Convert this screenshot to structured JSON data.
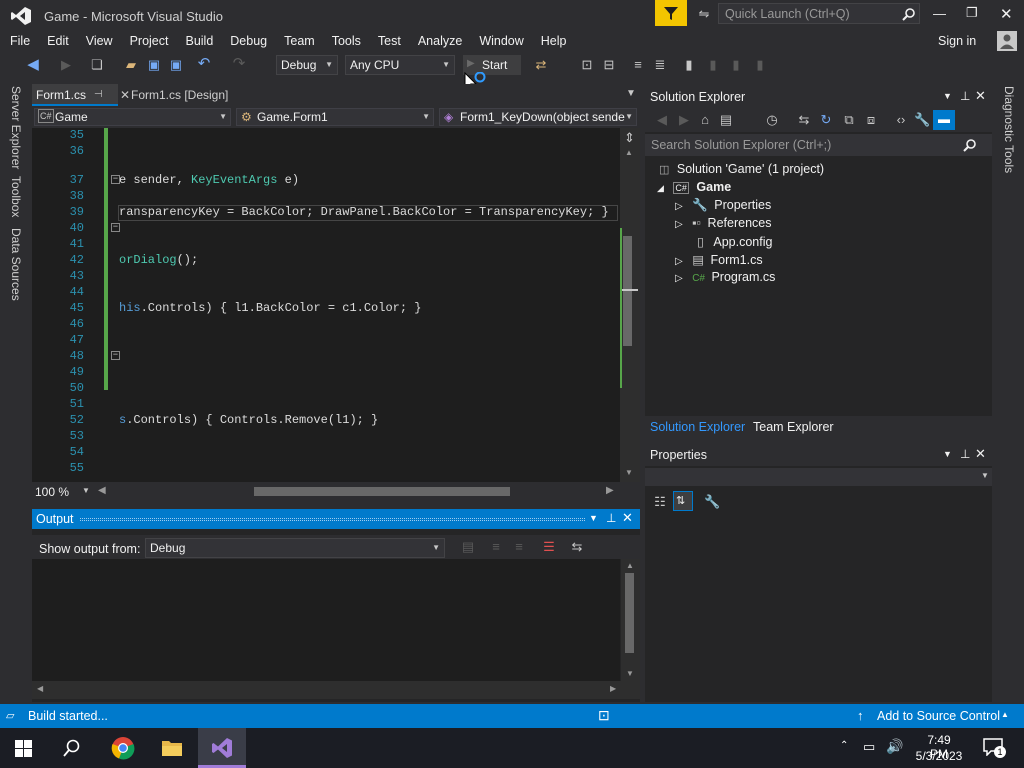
{
  "window": {
    "title": "Game - Microsoft Visual Studio",
    "quick_launch_placeholder": "Quick Launch (Ctrl+Q)"
  },
  "menu": [
    "File",
    "Edit",
    "View",
    "Project",
    "Build",
    "Debug",
    "Team",
    "Tools",
    "Test",
    "Analyze",
    "Window",
    "Help"
  ],
  "sign_in": "Sign in",
  "toolbar": {
    "config": "Debug",
    "platform": "Any CPU",
    "start": "Start"
  },
  "left_tabs": [
    "Server Explorer",
    "Toolbox",
    "Data Sources"
  ],
  "right_tab": "Diagnostic Tools",
  "editor": {
    "tabs": [
      "Form1.cs",
      "Form1.cs [Design]"
    ],
    "nav": [
      "Game",
      "Game.Form1",
      "Form1_KeyDown(object sender"
    ],
    "lines": [
      {
        "n": "35",
        "t": ""
      },
      {
        "n": "36",
        "t": ""
      },
      {
        "n": "37",
        "t": "e sender, KeyEventArgs e)"
      },
      {
        "n": "38",
        "t": ""
      },
      {
        "n": "39",
        "t": "ransparencyKey = BackColor; DrawPanel.BackColor = TransparencyKey; }"
      },
      {
        "n": "40",
        "t": ""
      },
      {
        "n": "41",
        "t": ""
      },
      {
        "n": "42",
        "t": "orDialog();"
      },
      {
        "n": "43",
        "t": ""
      },
      {
        "n": "44",
        "t": ""
      },
      {
        "n": "45",
        "t": "his.Controls) { l1.BackColor = c1.Color; }"
      },
      {
        "n": "46",
        "t": ""
      },
      {
        "n": "47",
        "t": ""
      },
      {
        "n": "48",
        "t": ""
      },
      {
        "n": "49",
        "t": ""
      },
      {
        "n": "50",
        "t": ""
      },
      {
        "n": "51",
        "t": ""
      },
      {
        "n": "52",
        "t": "s.Controls) { Controls.Remove(l1); }"
      },
      {
        "n": "53",
        "t": ""
      },
      {
        "n": "54",
        "t": ""
      },
      {
        "n": "55",
        "t": ""
      }
    ],
    "zoom": "100 %"
  },
  "output": {
    "title": "Output",
    "show_from_label": "Show output from:",
    "source": "Debug"
  },
  "solution_explorer": {
    "title": "Solution Explorer",
    "search_placeholder": "Search Solution Explorer (Ctrl+;)",
    "solution": "Solution 'Game' (1 project)",
    "project": "Game",
    "items": [
      "Properties",
      "References",
      "App.config",
      "Form1.cs",
      "Program.cs"
    ],
    "tabs": [
      "Solution Explorer",
      "Team Explorer"
    ]
  },
  "properties": {
    "title": "Properties"
  },
  "status": {
    "text": "Build started...",
    "source_control": "Add to Source Control"
  },
  "taskbar": {
    "time": "7:49 PM",
    "date": "5/3/2023",
    "notif_count": "1"
  }
}
